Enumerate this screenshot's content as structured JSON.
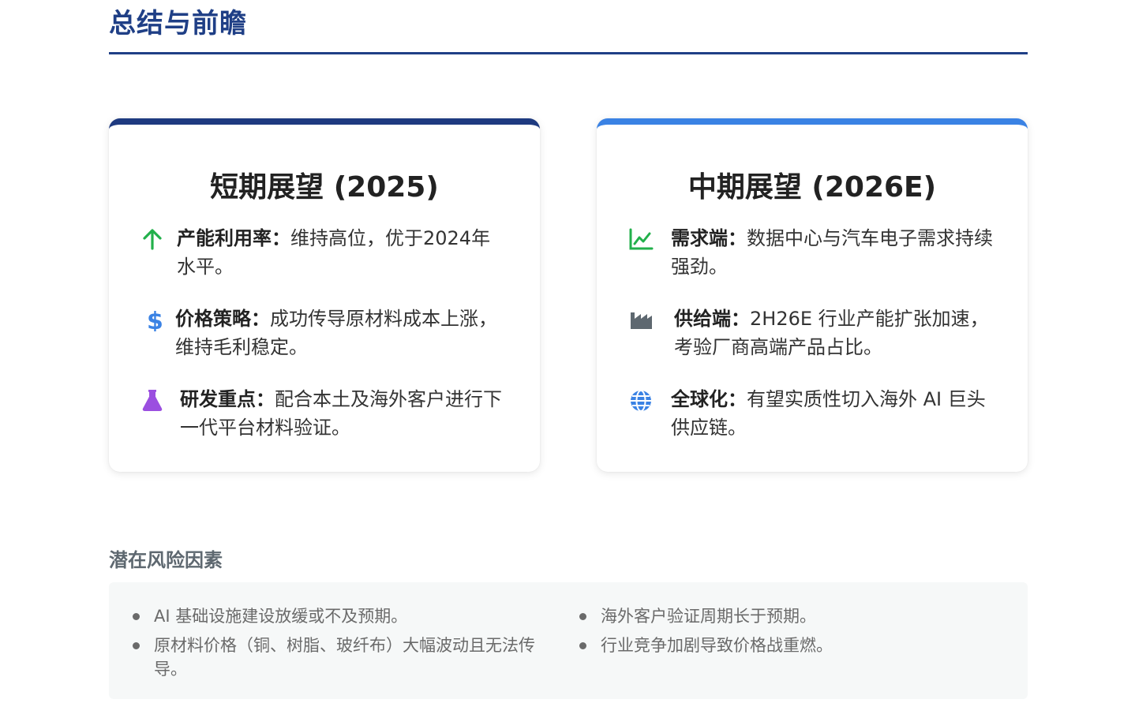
{
  "header": {
    "title": "总结与前瞻"
  },
  "cards": [
    {
      "title": "短期展望 (2025)",
      "items": [
        {
          "icon": "arrow-up-icon",
          "label": "产能利用率：",
          "text": "维持高位，优于2024年水平。"
        },
        {
          "icon": "dollar-icon",
          "label": "价格策略：",
          "text": "成功传导原材料成本上涨，维持毛利稳定。"
        },
        {
          "icon": "flask-icon",
          "label": "研发重点：",
          "text": "配合本土及海外客户进行下一代平台材料验证。"
        }
      ]
    },
    {
      "title": "中期展望 (2026E)",
      "items": [
        {
          "icon": "line-chart-icon",
          "label": "需求端：",
          "text": "数据中心与汽车电子需求持续强劲。"
        },
        {
          "icon": "factory-icon",
          "label": "供给端：",
          "text": "2H26E 行业产能扩张加速，考验厂商高端产品占比。"
        },
        {
          "icon": "globe-icon",
          "label": "全球化：",
          "text": "有望实质性切入海外 AI 巨头供应链。"
        }
      ]
    }
  ],
  "risks": {
    "title": "潜在风险因素",
    "left": [
      "AI 基础设施建设放缓或不及预期。",
      "原材料价格（铜、树脂、玻纤布）大幅波动且无法传导。"
    ],
    "right": [
      "海外客户验证周期长于预期。",
      "行业竞争加剧导致价格战重燃。"
    ]
  },
  "colors": {
    "title": "#1f3f86",
    "card_left_accent": "#1e3a80",
    "card_right_accent": "#3a82e4",
    "green": "#22b04b",
    "blue": "#3a82e4",
    "purple": "#9b4fe0",
    "gray": "#5e6870"
  }
}
